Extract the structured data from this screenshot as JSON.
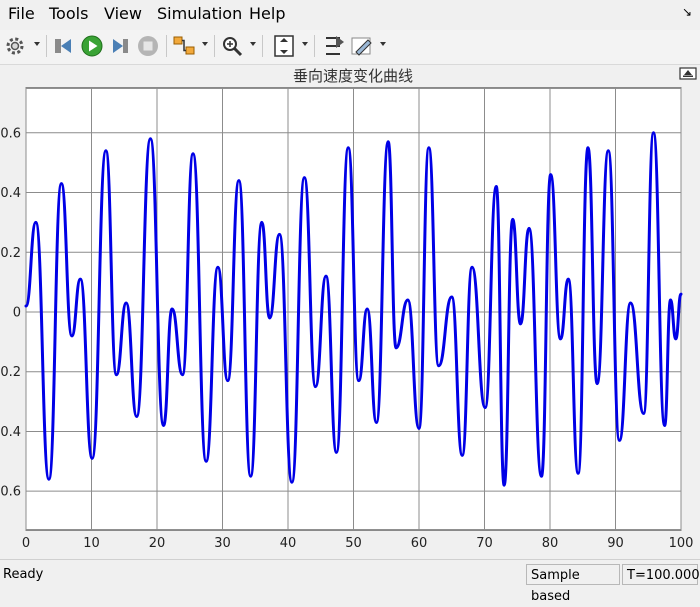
{
  "menu": [
    "File",
    "Tools",
    "View",
    "Simulation",
    "Help"
  ],
  "status": {
    "left": "Ready",
    "mode": "Sample based",
    "time": "T=100.000"
  },
  "chart_data": {
    "type": "line",
    "title": "垂向速度变化曲线",
    "xlabel": "",
    "ylabel": "",
    "xlim": [
      0,
      100
    ],
    "ylim": [
      -0.73,
      0.75
    ],
    "xticks": [
      0,
      10,
      20,
      30,
      40,
      50,
      60,
      70,
      80,
      90,
      100
    ],
    "yticks": [
      -0.6,
      -0.4,
      -0.2,
      0,
      0.2,
      0.4,
      0.6
    ],
    "ytick_labels": [
      "-0.6",
      "-0.4",
      "-0.2",
      "0",
      "0.2",
      "0.4",
      "0.6"
    ],
    "grid": true,
    "line_color": "#0000e6",
    "background": "#ffffff",
    "series": [
      {
        "x": [
          0,
          1.5,
          3.5,
          5.4,
          7.0,
          8.3,
          10.1,
          12.2,
          13.8,
          15.3,
          16.9,
          19.0,
          21.0,
          22.3,
          23.9,
          25.5,
          27.5,
          29.3,
          30.8,
          32.5,
          34.3,
          36.0,
          37.2,
          38.7,
          40.6,
          42.5,
          44.2,
          45.8,
          47.4,
          49.2,
          50.8,
          52.1,
          53.5,
          55.3,
          56.5,
          58.3,
          60.0,
          61.5,
          63.0,
          65.0,
          66.6,
          68.1,
          70.1,
          71.8,
          73.0,
          74.3,
          75.5,
          76.8,
          78.7,
          80.1,
          81.6,
          82.8,
          84.3,
          85.8,
          87.2,
          88.9,
          90.6,
          92.3,
          94.3,
          95.8,
          97.5,
          98.4,
          99.2,
          100
        ],
        "y": [
          0.02,
          0.3,
          -0.56,
          0.43,
          -0.08,
          0.11,
          -0.49,
          0.54,
          -0.21,
          0.03,
          -0.35,
          0.58,
          -0.38,
          0.01,
          -0.21,
          0.53,
          -0.5,
          0.15,
          -0.23,
          0.44,
          -0.55,
          0.3,
          -0.02,
          0.26,
          -0.57,
          0.45,
          -0.25,
          0.12,
          -0.47,
          0.55,
          -0.23,
          0.01,
          -0.37,
          0.57,
          -0.12,
          0.04,
          -0.39,
          0.55,
          -0.18,
          0.05,
          -0.48,
          0.15,
          -0.32,
          0.42,
          -0.58,
          0.31,
          -0.04,
          0.28,
          -0.55,
          0.46,
          -0.09,
          0.11,
          -0.54,
          0.55,
          -0.24,
          0.54,
          -0.43,
          0.03,
          -0.34,
          0.6,
          -0.38,
          0.04,
          -0.09,
          0.06
        ]
      }
    ]
  }
}
